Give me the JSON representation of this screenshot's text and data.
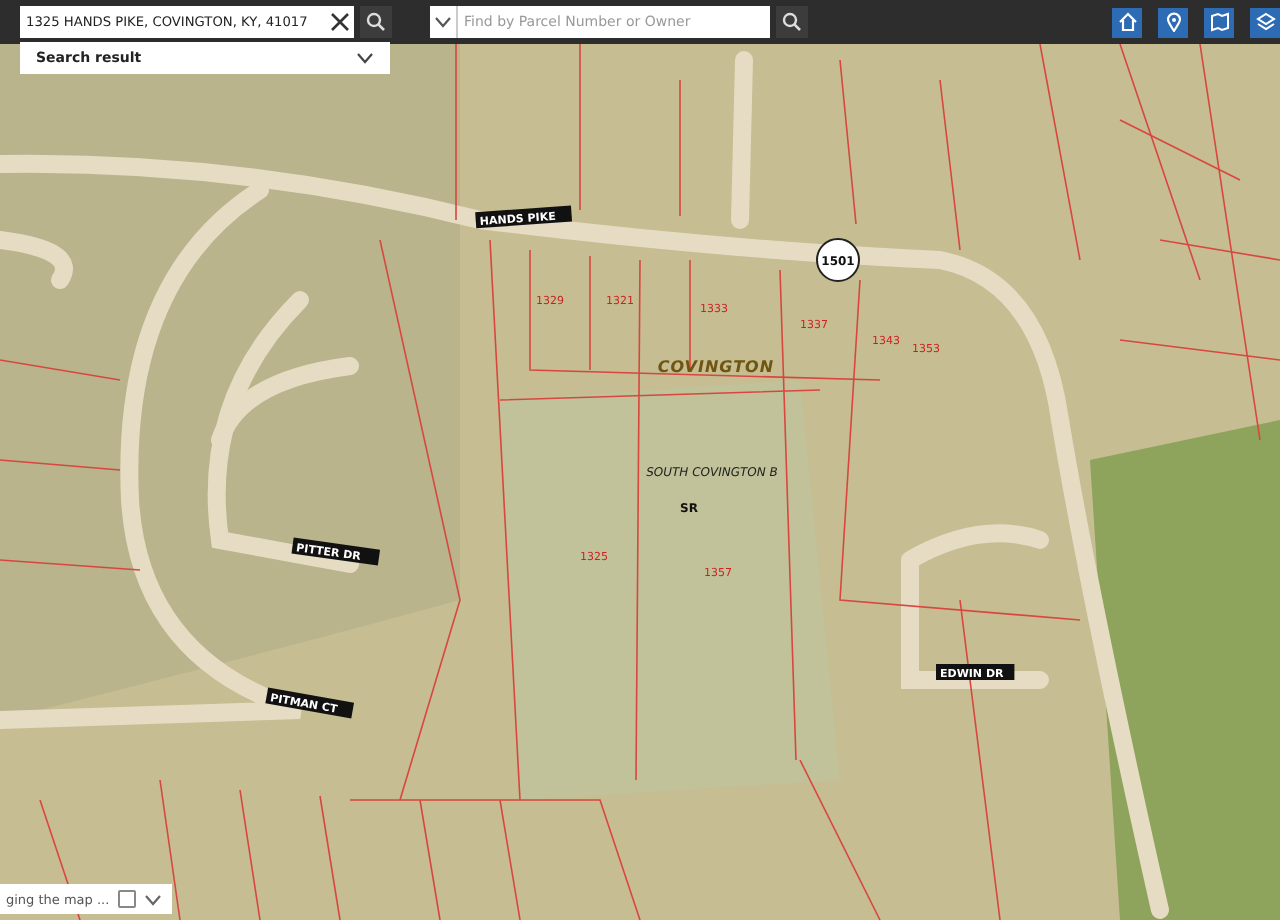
{
  "search": {
    "value": "1325 HANDS PIKE, COVINGTON, KY, 41017",
    "result_label": "Search result"
  },
  "parcel_search": {
    "placeholder": "Find by Parcel Number or Owner"
  },
  "map": {
    "road_labels": [
      "HANDS PIKE",
      "PITTER DR",
      "PITMAN CT",
      "EDWIN DR"
    ],
    "route_shield": "1501",
    "place_labels": [
      "COVINGTON",
      "SOUTH COVINGTON B"
    ],
    "zone_label": "SR",
    "parcel_numbers": [
      "1325",
      "1357",
      "1329",
      "1321",
      "1333",
      "1337",
      "1343",
      "1353"
    ]
  },
  "status": {
    "text": "ging the map ...",
    "checked": false
  }
}
